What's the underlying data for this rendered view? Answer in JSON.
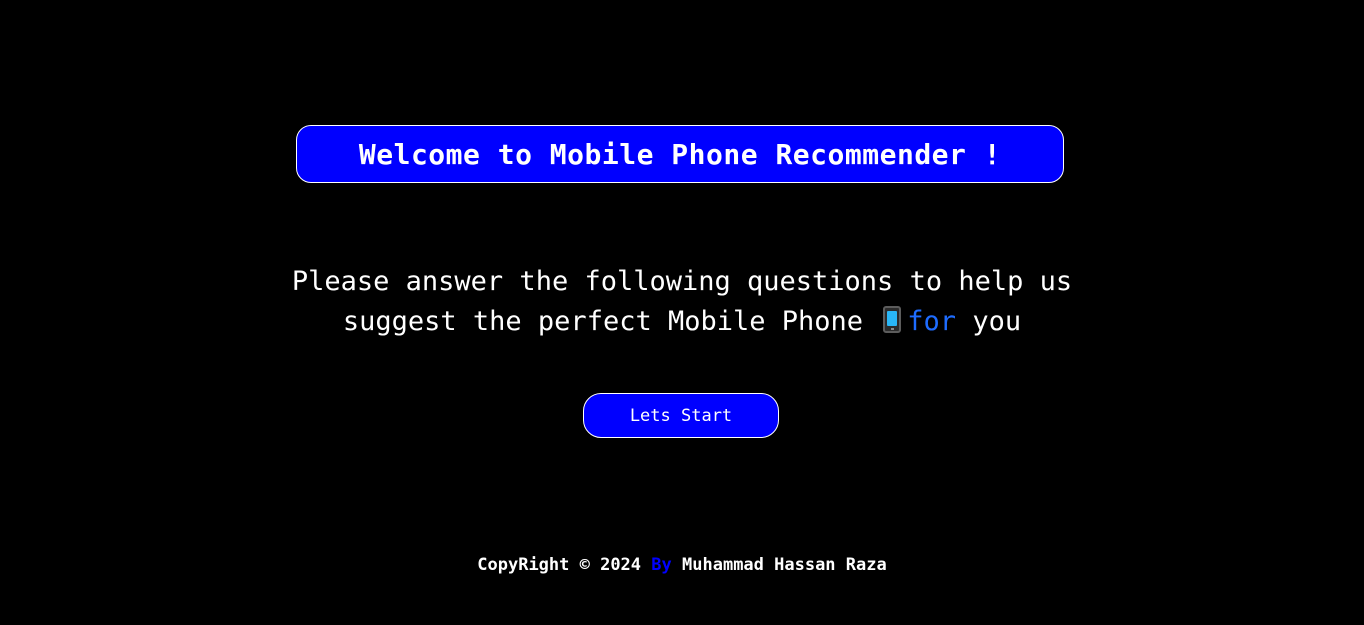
{
  "header": {
    "title": "Welcome to Mobile Phone Recommender !"
  },
  "intro": {
    "line1": "Please answer the following questions to help us",
    "line2_start": "suggest the perfect Mobile Phone",
    "phone_icon": "mobile-phone-icon",
    "highlight_word": "for",
    "line2_end": "you"
  },
  "actions": {
    "start_label": "Lets Start"
  },
  "footer": {
    "copyright": "CopyRight © 2024",
    "by": "By",
    "author": "Muhammad Hassan Raza"
  },
  "colors": {
    "background": "#000000",
    "accent_blue": "#0000ff",
    "highlight_blue": "#1e6cff",
    "text": "#ffffff"
  }
}
